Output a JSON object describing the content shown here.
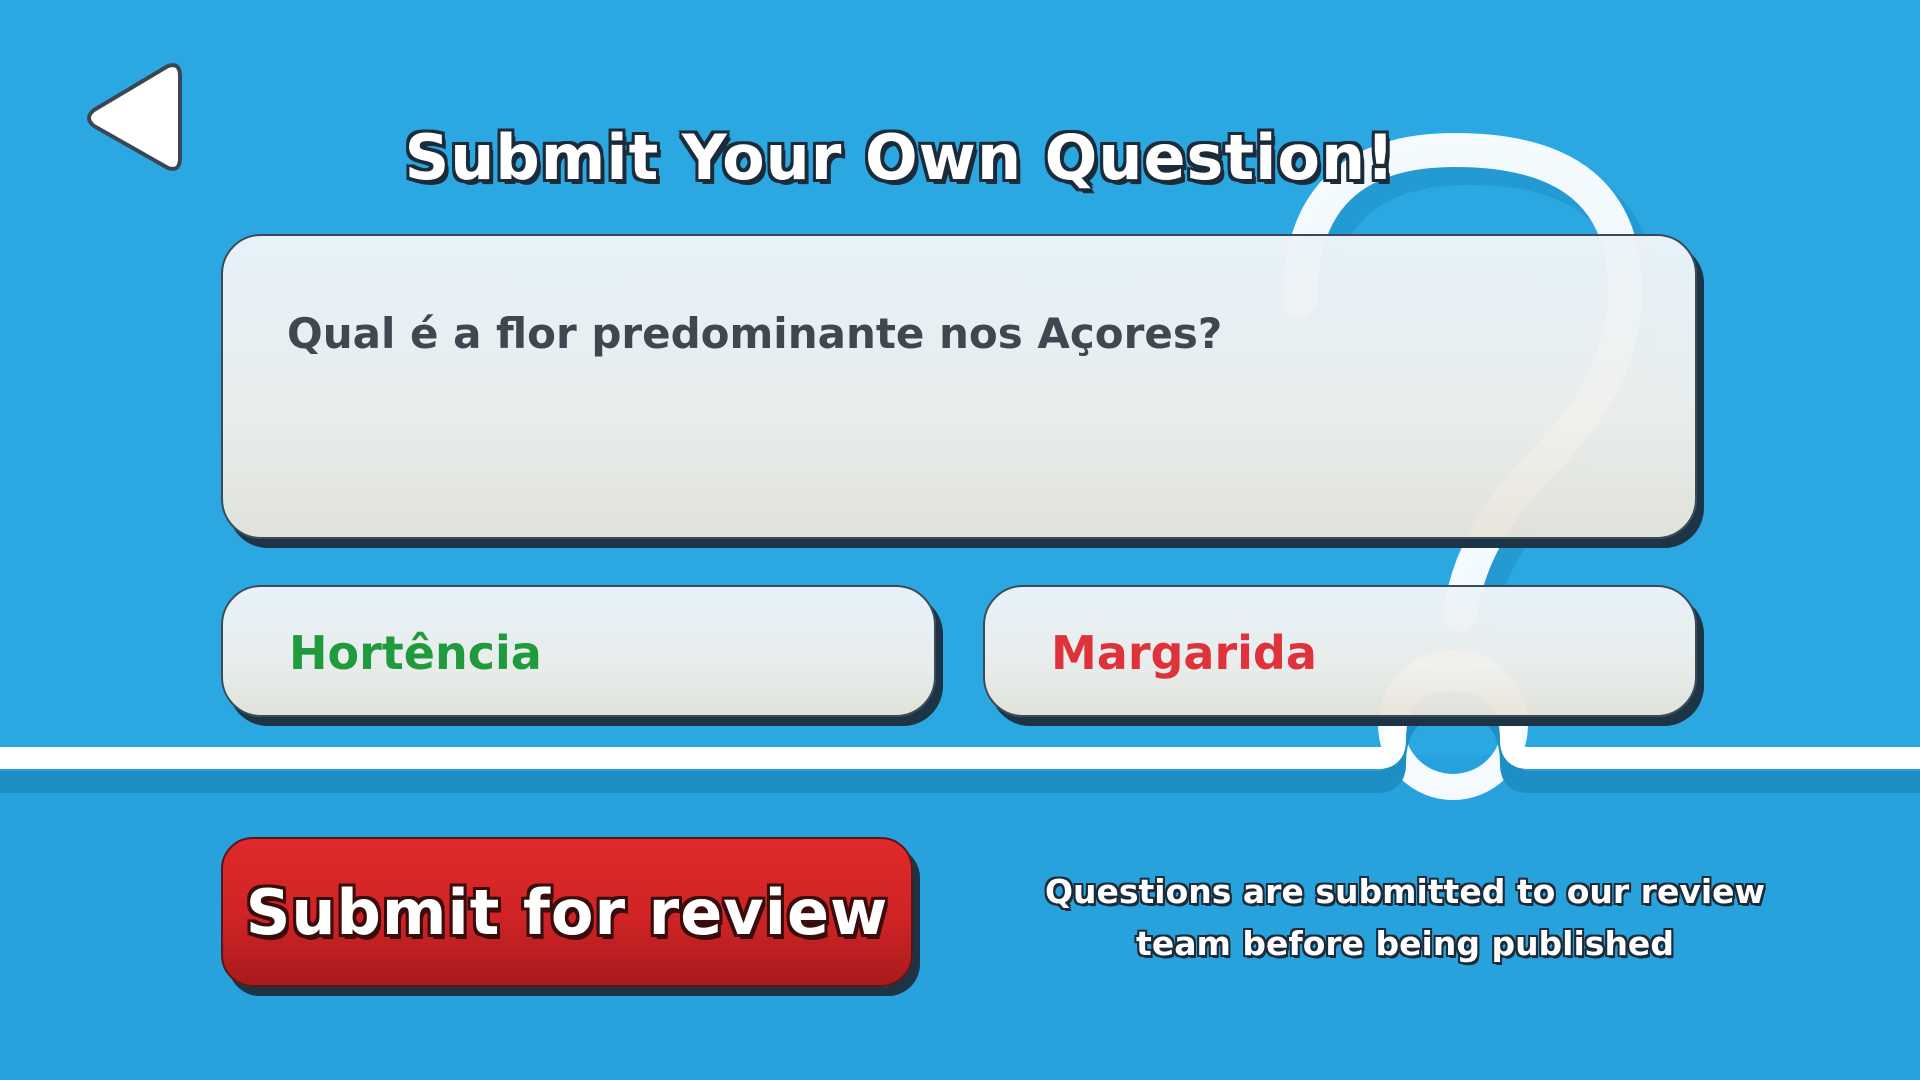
{
  "screen": {
    "title": "Submit Your Own Question!",
    "background_color": "#2ba8e2"
  },
  "back_button": {
    "icon": "back-arrow-icon"
  },
  "question": {
    "text": "Qual é a flor predominante nos Açores?"
  },
  "answers": {
    "correct": {
      "text": "Hortência",
      "color": "#1f9a3c"
    },
    "wrong": {
      "text": "Margarida",
      "color": "#e0323a"
    }
  },
  "submit": {
    "label": "Submit for review",
    "color": "#d6262a"
  },
  "note": {
    "line1": "Questions are submitted to our review",
    "line2": "team before being published"
  },
  "decoration": {
    "icon": "question-mark-icon"
  }
}
